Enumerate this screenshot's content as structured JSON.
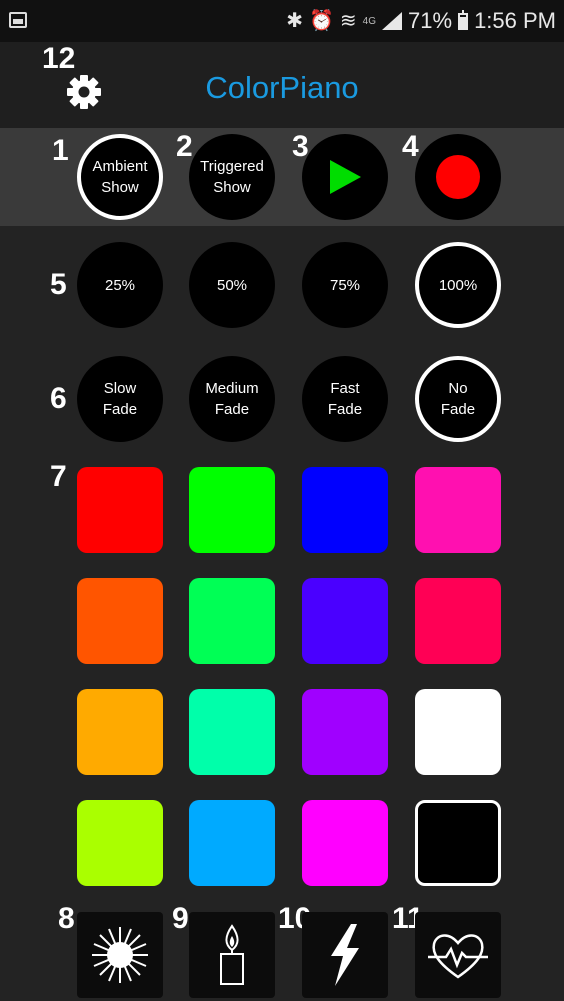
{
  "status_bar": {
    "battery_percent": "71%",
    "time": "1:56 PM",
    "network": "4G",
    "icons": [
      "gallery-icon",
      "bluetooth-icon",
      "alarm-icon",
      "wifi-icon",
      "signal-icon",
      "battery-icon"
    ]
  },
  "app": {
    "title": "ColorPiano",
    "settings_icon": "gear-icon"
  },
  "markers": [
    "1",
    "2",
    "3",
    "4",
    "5",
    "6",
    "7",
    "8",
    "9",
    "10",
    "11",
    "12"
  ],
  "mode_buttons": [
    {
      "line1": "Ambient",
      "line2": "Show",
      "selected": true
    },
    {
      "line1": "Triggered",
      "line2": "Show",
      "selected": false
    },
    {
      "icon": "play-icon",
      "color": "#00dd00"
    },
    {
      "icon": "record-icon",
      "color": "#ff0000"
    }
  ],
  "brightness_buttons": [
    {
      "label": "25%",
      "selected": false
    },
    {
      "label": "50%",
      "selected": false
    },
    {
      "label": "75%",
      "selected": false
    },
    {
      "label": "100%",
      "selected": true
    }
  ],
  "fade_buttons": [
    {
      "line1": "Slow",
      "line2": "Fade",
      "selected": false
    },
    {
      "line1": "Medium",
      "line2": "Fade",
      "selected": false
    },
    {
      "line1": "Fast",
      "line2": "Fade",
      "selected": false
    },
    {
      "line1": "No",
      "line2": "Fade",
      "selected": true
    }
  ],
  "color_swatches": [
    [
      "#ff0000",
      "#00ff00",
      "#0000ff",
      "#ff10b0"
    ],
    [
      "#ff5500",
      "#00ff55",
      "#4a00ff",
      "#ff0055"
    ],
    [
      "#ffaa00",
      "#00ffaa",
      "#a000ff",
      "#ffffff"
    ],
    [
      "#aaff00",
      "#00aaff",
      "#ff00ff",
      "#000000"
    ]
  ],
  "effect_buttons": [
    "sunburst-icon",
    "candle-icon",
    "lightning-icon",
    "heartbeat-icon"
  ]
}
